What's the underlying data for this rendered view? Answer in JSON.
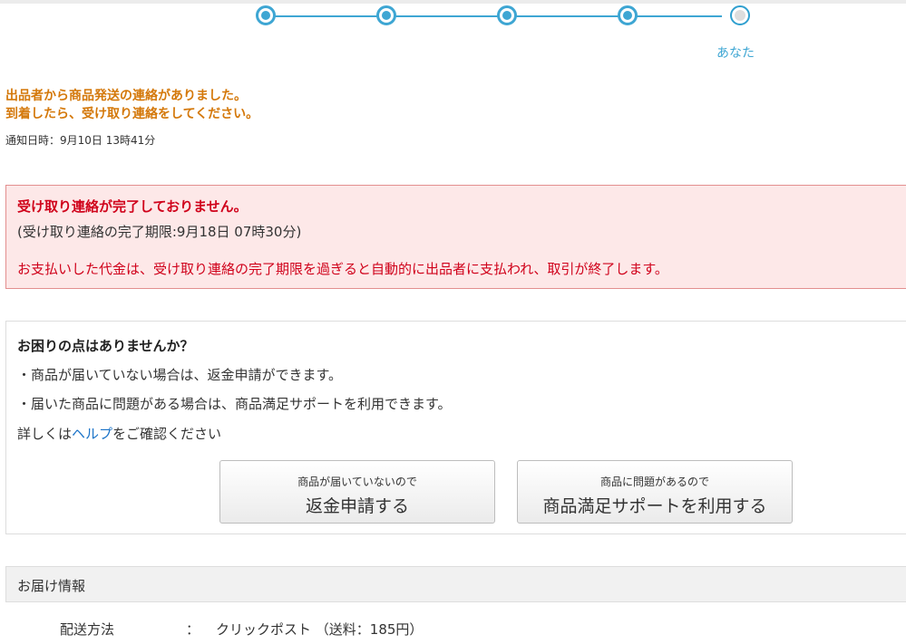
{
  "progress": {
    "steps_completed": 4,
    "steps_total": 5,
    "current_step_label": "あなた"
  },
  "notice": {
    "line1": "出品者から商品発送の連絡がありました。",
    "line2": "到着したら、受け取り連絡をしてください。",
    "date": "通知日時：9月10日 13時41分"
  },
  "warning": {
    "title": "受け取り連絡が完了しておりません。",
    "deadline": "(受け取り連絡の完了期限:9月18日 07時30分)",
    "body": "お支払いした代金は、受け取り連絡の完了期限を過ぎると自動的に出品者に支払われ、取引が終了します。"
  },
  "help": {
    "heading": "お困りの点はありませんか？",
    "bullet1": "・商品が届いていない場合は、返金申請ができます。",
    "bullet2": "・届いた商品に問題がある場合は、商品満足サポートを利用できます。",
    "more_prefix": "詳しくは",
    "more_link": "ヘルプ",
    "more_suffix": "をご確認ください"
  },
  "buttons": {
    "refund_small": "商品が届いていないので",
    "refund_big": "返金申請する",
    "support_small": "商品に問題があるので",
    "support_big": "商品満足サポートを利用する"
  },
  "delivery": {
    "header": "お届け情報",
    "method_label": "配送方法",
    "colon": "：",
    "method_value": "クリックポスト （送料：185円）"
  },
  "colors": {
    "accent_blue": "#3ea6d3",
    "notice_orange": "#d4780a",
    "warning_red": "#d0021b",
    "warning_bg": "#fde8e8",
    "link_blue": "#1a73c8"
  }
}
